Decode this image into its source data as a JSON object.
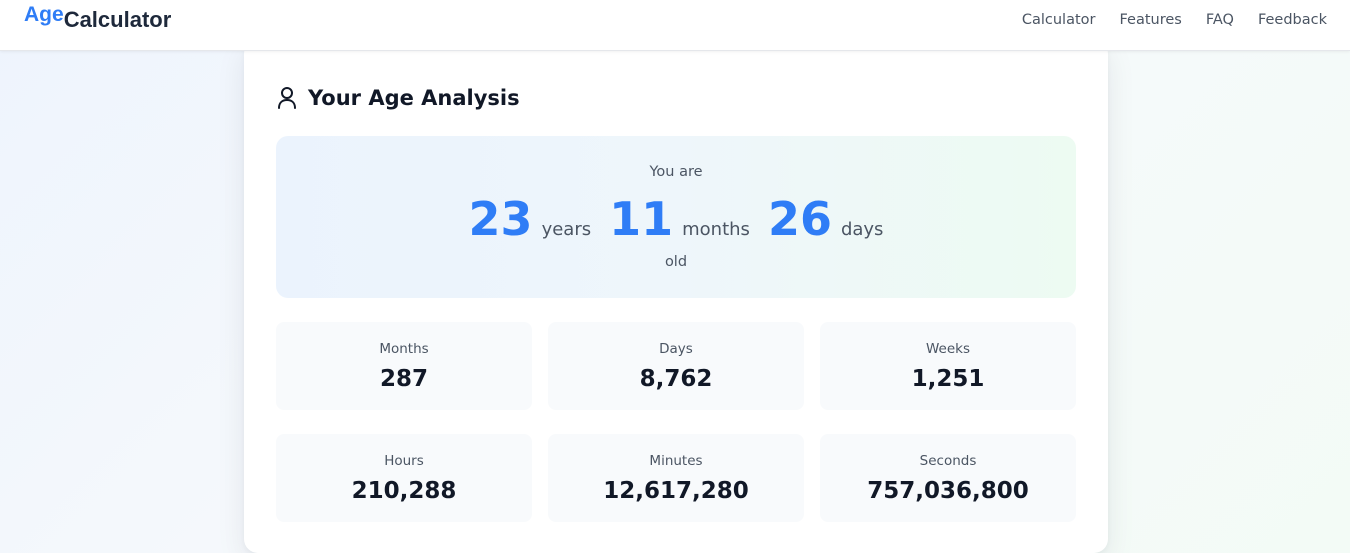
{
  "header": {
    "logo_accent": "Age",
    "logo_main": "Calculator",
    "nav": [
      "Calculator",
      "Features",
      "FAQ",
      "Feedback"
    ]
  },
  "card": {
    "title": "Your Age Analysis",
    "title_icon": "user-icon",
    "hero": {
      "prefix": "You are",
      "years": "23",
      "years_unit": "years",
      "months": "11",
      "months_unit": "months",
      "days": "26",
      "days_unit": "days",
      "suffix": "old"
    },
    "stats": [
      {
        "label": "Months",
        "value": "287"
      },
      {
        "label": "Days",
        "value": "8,762"
      },
      {
        "label": "Weeks",
        "value": "1,251"
      },
      {
        "label": "Hours",
        "value": "210,288"
      },
      {
        "label": "Minutes",
        "value": "12,617,280"
      },
      {
        "label": "Seconds",
        "value": "757,036,800"
      }
    ]
  },
  "colors": {
    "accent": "#2f7df6",
    "heading": "#111827",
    "muted": "#4b5563",
    "stat_bg": "#f8fafc"
  }
}
